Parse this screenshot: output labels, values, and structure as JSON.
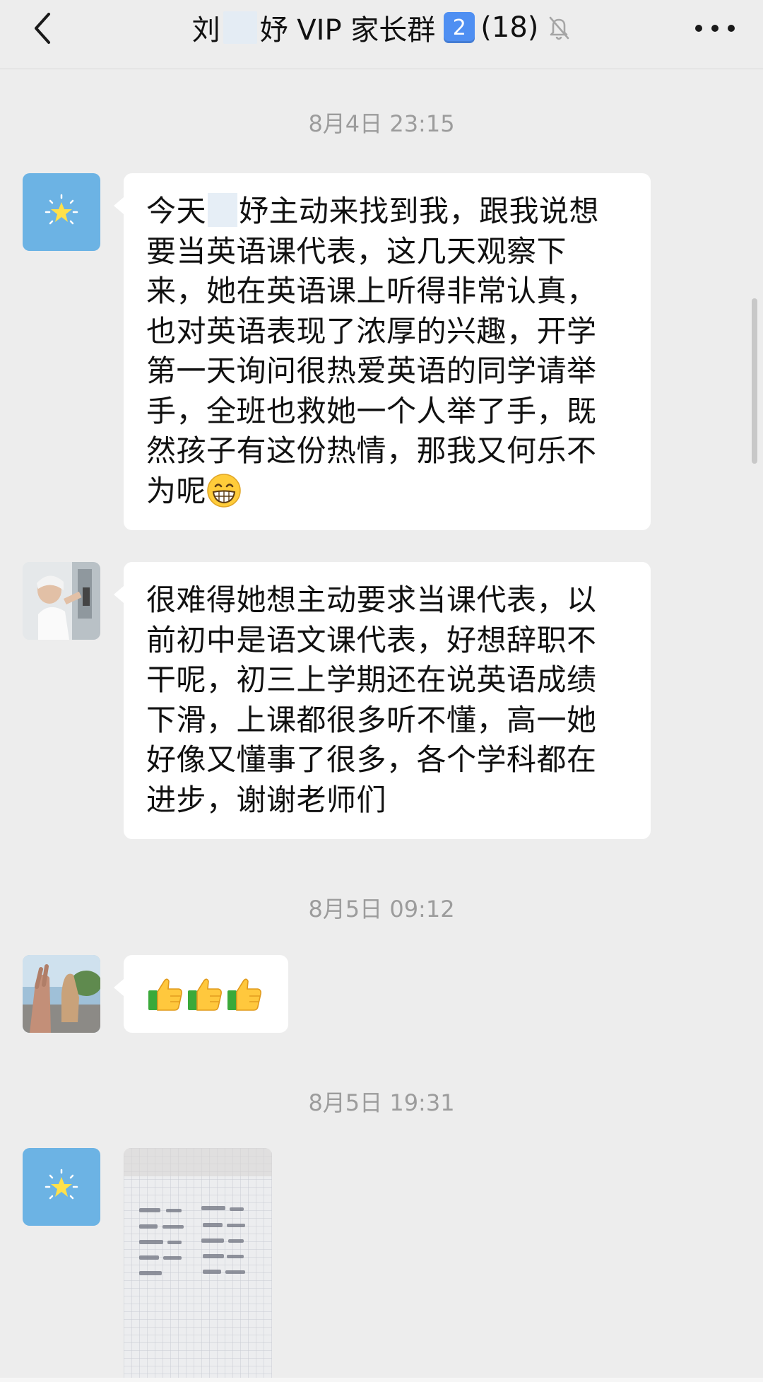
{
  "header": {
    "title_prefix": "刘",
    "title_suffix": "妤 VIP 家长群",
    "group_number_badge": "2",
    "member_count": "(18)",
    "muted_icon": "bell-slash-icon",
    "back_icon": "chevron-left-icon",
    "more_icon": "more-horizontal-icon"
  },
  "messages": [
    {
      "timestamp": "8月4日 23:15",
      "sender_avatar": "star-avatar",
      "lines": [
        {
          "before": "今天",
          "mask": true,
          "after": "妤主动来找到我，跟我说想"
        },
        {
          "text": "要当英语课代表，这几天观察下"
        },
        {
          "text": "来，她在英语课上听得非常认真，"
        },
        {
          "text": "也对英语表现了浓厚的兴趣，开学"
        },
        {
          "text": "第一天询问很热爱英语的同学请举"
        },
        {
          "text": "手，全班也救她一个人举了手，既"
        },
        {
          "text": "然孩子有这份热情，那我又何乐不"
        },
        {
          "text": "为呢",
          "emoji": "grinning-face-emoji"
        }
      ]
    },
    {
      "sender_avatar": "photo-avatar-woman",
      "lines": [
        {
          "text": "很难得她想主动要求当课代表，以"
        },
        {
          "text": "前初中是语文课代表，好想辞职不"
        },
        {
          "text": "干呢，初三上学期还在说英语成绩"
        },
        {
          "text": "下滑，上课都很多听不懂，高一她"
        },
        {
          "text": "好像又懂事了很多，各个学科都在"
        },
        {
          "text": "进步，谢谢老师们"
        }
      ]
    },
    {
      "timestamp": "8月5日 09:12",
      "sender_avatar": "photo-avatar-hand",
      "emojis": [
        "thumbs-up-emoji",
        "thumbs-up-emoji",
        "thumbs-up-emoji"
      ]
    },
    {
      "timestamp": "8月5日 19:31",
      "sender_avatar": "star-avatar",
      "image": "notebook-photo"
    }
  ],
  "colors": {
    "background": "#ededed",
    "bubble": "#ffffff",
    "timestamp_text": "#9c9c9c",
    "star_avatar": "#6cb3e4",
    "badge": "#4f8ff2"
  }
}
